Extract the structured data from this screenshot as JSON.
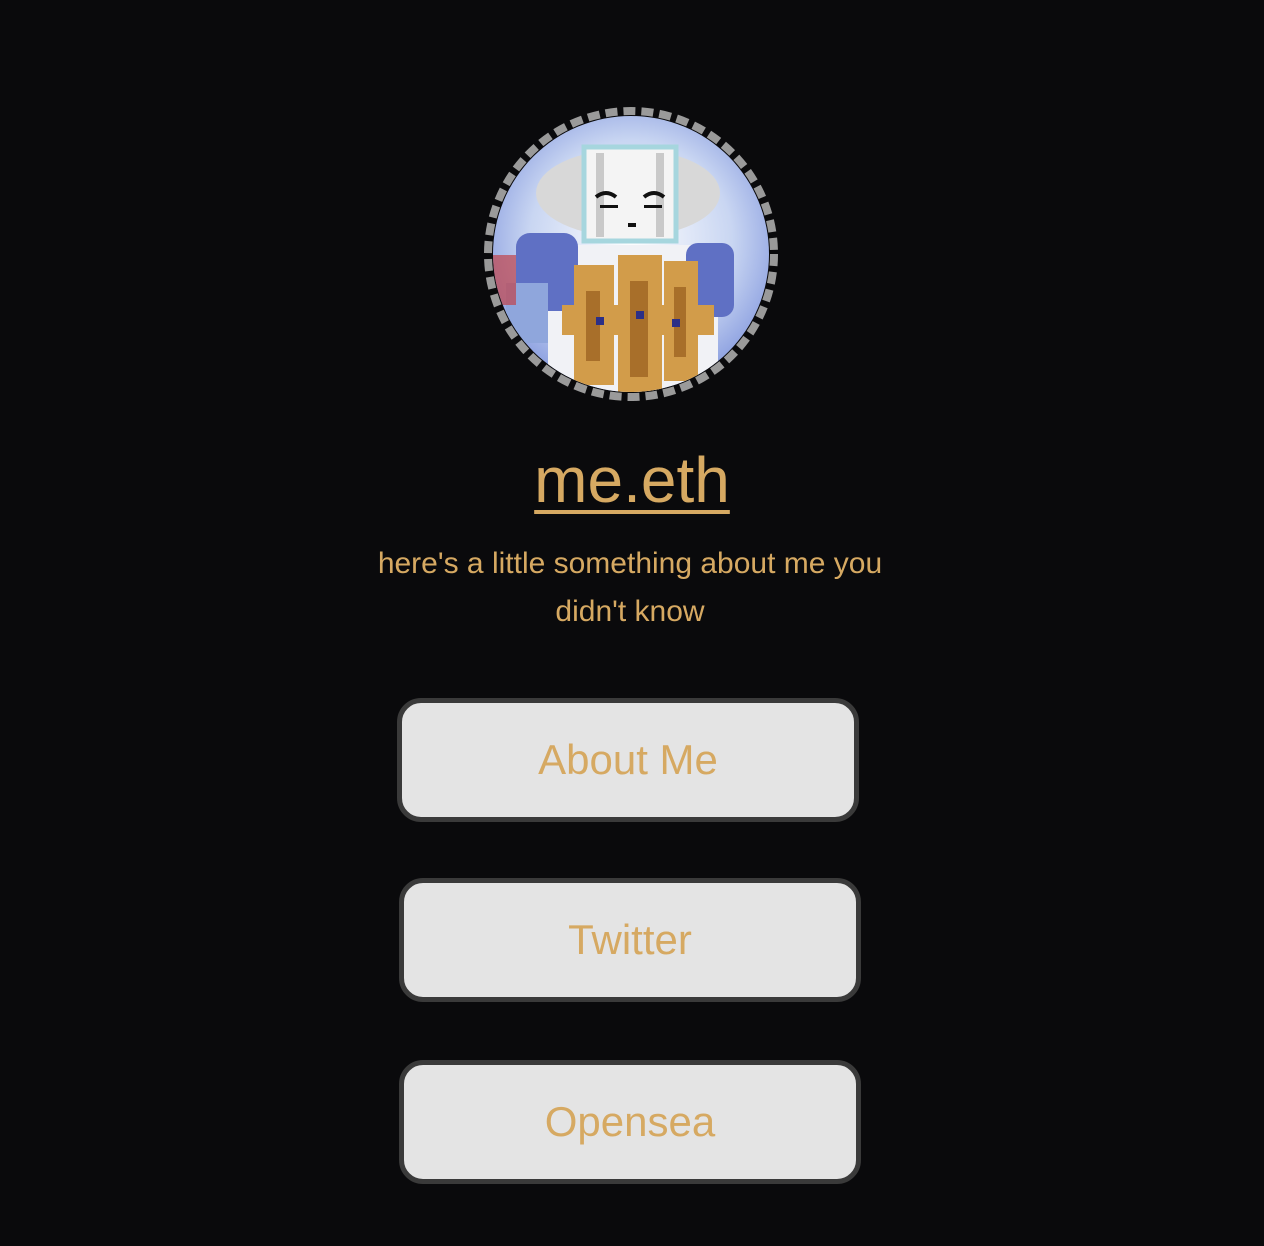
{
  "profile": {
    "avatar_alt": "pixel-art robot avatar",
    "name": "me.eth",
    "bio": "here's a little something about me you didn't know"
  },
  "links": [
    {
      "label": "About Me"
    },
    {
      "label": "Twitter"
    },
    {
      "label": "Opensea"
    }
  ],
  "colors": {
    "background": "#0a0a0c",
    "accent": "#d6a962",
    "button_bg": "#e4e4e4",
    "button_border": "#3a3a3a"
  }
}
